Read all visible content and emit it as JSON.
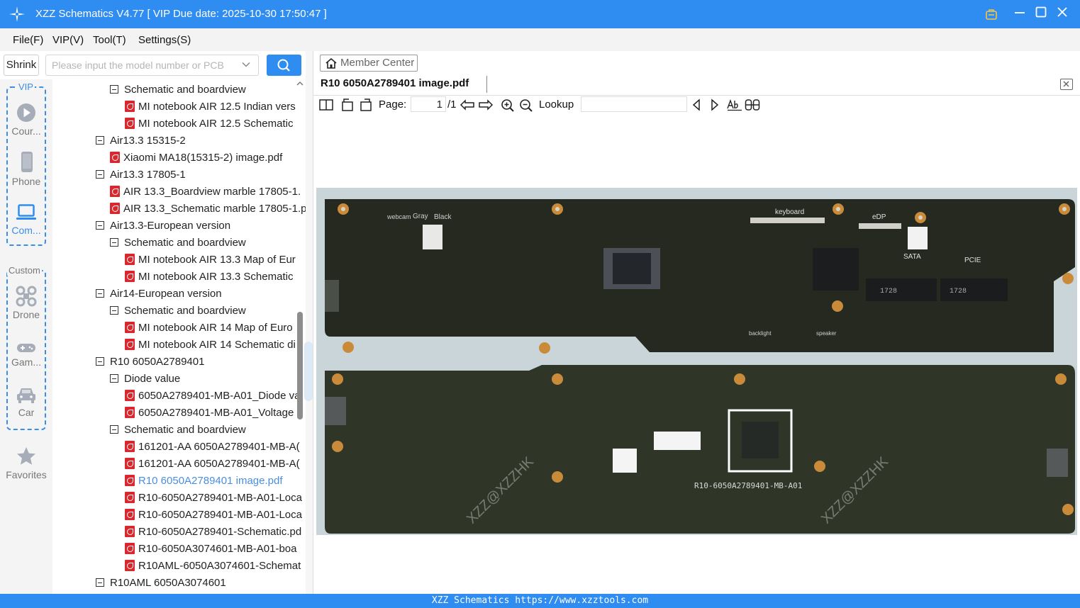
{
  "window": {
    "title": "XZZ Schematics V4.77 [ VIP Due date: 2025-10-30 17:50:47 ]",
    "controls": [
      "minimize-icon",
      "maximize-icon",
      "close-icon"
    ]
  },
  "menu": {
    "items": [
      "File(F)",
      "VIP(V)",
      "Tool(T)",
      "Settings(S)"
    ]
  },
  "search": {
    "shrink_label": "Shrink",
    "placeholder": "Please input the model number or PCB"
  },
  "categories": {
    "vip_label": "VIP",
    "custom_label": "Custom",
    "vip_items": [
      {
        "label": "Cour...",
        "icon": "play-icon"
      },
      {
        "label": "Phone",
        "icon": "phone-icon"
      },
      {
        "label": "Com...",
        "icon": "laptop-icon"
      }
    ],
    "custom_items": [
      {
        "label": "Drone",
        "icon": "drone-icon"
      },
      {
        "label": "Gam...",
        "icon": "gamepad-icon"
      },
      {
        "label": "Car",
        "icon": "car-icon"
      }
    ],
    "favorites_label": "Favorites"
  },
  "tree": {
    "nodes": [
      {
        "label": "Schematic and boardview",
        "type": "folder",
        "level": 2
      },
      {
        "label": "MI notebook AIR 12.5 Indian vers",
        "type": "pdf",
        "level": 3
      },
      {
        "label": "MI notebook AIR 12.5 Schematic",
        "type": "pdf",
        "level": 3
      },
      {
        "label": "Air13.3 15315-2",
        "type": "folder",
        "level": 1
      },
      {
        "label": "Xiaomi MA18(15315-2) image.pdf",
        "type": "pdf",
        "level": 2
      },
      {
        "label": "Air13.3 17805-1",
        "type": "folder",
        "level": 1
      },
      {
        "label": "AIR 13.3_Boardview marble 17805-1.",
        "type": "pdf",
        "level": 2
      },
      {
        "label": "AIR 13.3_Schematic marble 17805-1.p",
        "type": "pdf",
        "level": 2
      },
      {
        "label": "Air13.3-European version",
        "type": "folder",
        "level": 1
      },
      {
        "label": "Schematic and boardview",
        "type": "folder",
        "level": 2
      },
      {
        "label": "MI notebook AIR 13.3 Map of Eur",
        "type": "pdf",
        "level": 3
      },
      {
        "label": "MI notebook AIR 13.3 Schematic",
        "type": "pdf",
        "level": 3
      },
      {
        "label": "Air14-European version",
        "type": "folder",
        "level": 1
      },
      {
        "label": "Schematic and boardview",
        "type": "folder",
        "level": 2
      },
      {
        "label": "MI notebook AIR 14 Map of Euro",
        "type": "pdf",
        "level": 3
      },
      {
        "label": "MI notebook AIR 14 Schematic di",
        "type": "pdf",
        "level": 3
      },
      {
        "label": "R10 6050A2789401",
        "type": "folder",
        "level": 1
      },
      {
        "label": "Diode value",
        "type": "folder",
        "level": 2
      },
      {
        "label": "6050A2789401-MB-A01_Diode va",
        "type": "pdf",
        "level": 3
      },
      {
        "label": "6050A2789401-MB-A01_Voltage (",
        "type": "pdf",
        "level": 3
      },
      {
        "label": "Schematic and boardview",
        "type": "folder",
        "level": 2
      },
      {
        "label": "161201-AA 6050A2789401-MB-A(",
        "type": "pdf",
        "level": 3
      },
      {
        "label": "161201-AA 6050A2789401-MB-A(",
        "type": "pdf",
        "level": 3
      },
      {
        "label": "R10 6050A2789401 image.pdf",
        "type": "pdf",
        "level": 3,
        "selected": true
      },
      {
        "label": "R10-6050A2789401-MB-A01-Loca",
        "type": "pdf",
        "level": 3
      },
      {
        "label": "R10-6050A2789401-MB-A01-Loca",
        "type": "pdf",
        "level": 3
      },
      {
        "label": "R10-6050A2789401-Schematic.pd",
        "type": "pdf",
        "level": 3
      },
      {
        "label": "R10-6050A3074601-MB-A01-boa",
        "type": "pdf",
        "level": 3
      },
      {
        "label": "R10AML-6050A3074601-Schemat",
        "type": "pdf",
        "level": 3
      },
      {
        "label": "R10AML 6050A3074601",
        "type": "folder",
        "level": 1
      }
    ]
  },
  "viewer": {
    "member_center": "Member Center",
    "doc_tab": "R10 6050A2789401 image.pdf",
    "toolbar": {
      "page_label": "Page:",
      "page_value": "1",
      "page_total": "/1",
      "lookup_label": "Lookup",
      "lookup_value": ""
    },
    "board_labels": {
      "webcam": "webcam",
      "gray": "Gray",
      "black": "Black",
      "keyboard": "keyboard",
      "edp": "eDP",
      "sata": "SATA",
      "pcie": "PCIE",
      "backlight": "backlight",
      "speaker": "speaker",
      "bottom_id": "R10-6050A2789401-MB-A01",
      "ssd1": "1728",
      "ssd2": "1728"
    },
    "watermark": "XZZ@XZZHK"
  },
  "status": {
    "text": "XZZ Schematics https://www.xzztools.com"
  }
}
